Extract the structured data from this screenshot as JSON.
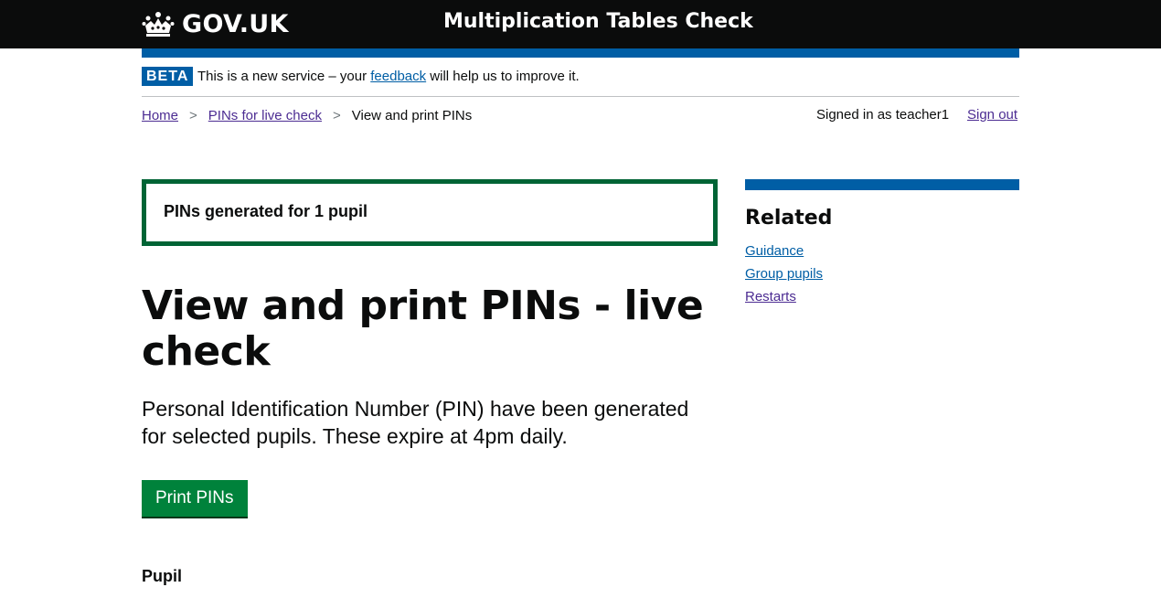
{
  "header": {
    "logo_text": "GOV.UK",
    "logo_icon": "crown-icon",
    "service_name": "Multiplication Tables Check"
  },
  "phase_banner": {
    "tag": "BETA",
    "text_before": "This is a new service – your ",
    "feedback_link": "feedback",
    "text_after": " will help us to improve it."
  },
  "breadcrumbs": {
    "items": [
      {
        "label": "Home"
      },
      {
        "label": "PINs for live check"
      },
      {
        "label": "View and print PINs"
      }
    ],
    "separator": ">"
  },
  "account": {
    "signed_in_text": "Signed in as teacher1",
    "sign_out": "Sign out"
  },
  "notification": {
    "text": "PINs generated for 1 pupil"
  },
  "main": {
    "title": "View and print PINs - live check",
    "lede": "Personal Identification Number (PIN) have been generated for selected pupils. These expire at 4pm daily.",
    "print_button": "Print PINs",
    "pupil_heading": "Pupil"
  },
  "related": {
    "title": "Related",
    "links": [
      {
        "label": "Guidance"
      },
      {
        "label": "Group pupils"
      },
      {
        "label": "Restarts"
      }
    ]
  },
  "colors": {
    "header_bg": "#0b0c0c",
    "brand_blue": "#005ea5",
    "success_green": "#006435",
    "button_green": "#00823b",
    "visited_link": "#4c2c92"
  }
}
